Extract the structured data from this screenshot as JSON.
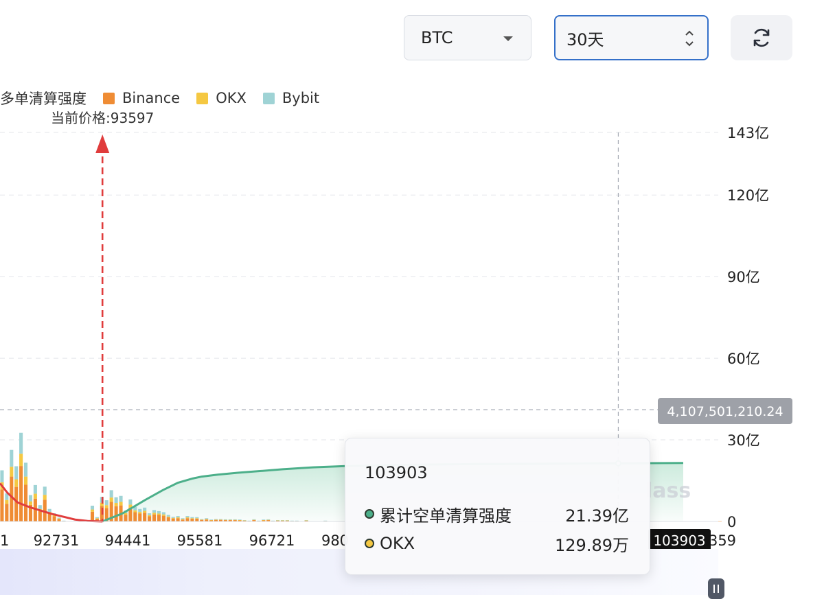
{
  "controls": {
    "coin_select": {
      "value": "BTC"
    },
    "period_select": {
      "value": "30天"
    },
    "refresh": {
      "icon": "refresh-icon"
    }
  },
  "legend": {
    "items": [
      {
        "label": "多单清算强度",
        "color": null
      },
      {
        "label": "Binance",
        "color": "#ef8c34"
      },
      {
        "label": "OKX",
        "color": "#f5c842"
      },
      {
        "label": "Bybit",
        "color": "#9fd3d5"
      }
    ]
  },
  "current_price_label": "当前价格:93597",
  "hover_y_value": "4,107,501,210.24",
  "hover_x_value": "103903",
  "watermark": "lass",
  "tooltip": {
    "title": "103903",
    "rows": [
      {
        "name": "累计空单清算强度",
        "value": "21.39亿",
        "color": "#4caf8a"
      },
      {
        "name": "OKX",
        "value": "129.89万",
        "color": "#f5c842"
      }
    ]
  },
  "chart_data": {
    "type": "bar",
    "y_axis": {
      "position": "right",
      "ticks": [
        {
          "label": "0",
          "value": 0
        },
        {
          "label": "30亿",
          "value": 3000000000
        },
        {
          "label": "60亿",
          "value": 6000000000
        },
        {
          "label": "90亿",
          "value": 9000000000
        },
        {
          "label": "120亿",
          "value": 12000000000
        },
        {
          "label": "143亿",
          "value": 14300000000
        }
      ],
      "ylim": [
        0,
        14300000000
      ]
    },
    "x_axis": {
      "tick_labels": [
        "1",
        "92731",
        "94441",
        "95581",
        "96721",
        "980",
        "103903",
        "359"
      ],
      "xlim": [
        91550,
        105900
      ]
    },
    "current_price": 93597,
    "hover_x": 103903,
    "hover_y": 4107501210.24,
    "x_start": 91590,
    "x_step": 95,
    "stacked_series": [
      {
        "name": "Binance",
        "color": "#ef8c34",
        "values": [
          11.8,
          6.5,
          16.5,
          12.7,
          20.4,
          13.5,
          6.1,
          8.4,
          3.8,
          8.0,
          2.9,
          1.9,
          0.9,
          0.2,
          0.1,
          0.1,
          0.1,
          0.2,
          0.1,
          3.6,
          1.0,
          5.7,
          4.9,
          7.2,
          5.6,
          5.9,
          2.5,
          5.1,
          3.4,
          2.9,
          3.2,
          1.9,
          2.6,
          2.4,
          2.1,
          1.5,
          1.1,
          1.2,
          0.7,
          1.2,
          1.0,
          1.0,
          0.6,
          0.7,
          0.4,
          0.6,
          0.6,
          0.5,
          0.5,
          0.5,
          0.4,
          0.3,
          0.2,
          0.5,
          0.2,
          0.4,
          0.5,
          0.2,
          0.3,
          0.3,
          0.3,
          0.2,
          0.2,
          0.1,
          0.3,
          0.1,
          0.1,
          0.1,
          0.2,
          0.1,
          0.1,
          0.1,
          0.0,
          0.1,
          0.0,
          0.1,
          0.0,
          0.0,
          0.1,
          0.0,
          0.0,
          0.0,
          0.0,
          0.0,
          0.0,
          0.0,
          0.0,
          0.0,
          0.1,
          0.0,
          0.1,
          0.0,
          0.0,
          0.0,
          0.0,
          0.1,
          0.0,
          0.0,
          0.0,
          0.0,
          0.1,
          0.0,
          0.1,
          0.0,
          0.1,
          0.0,
          0.1,
          0.1,
          0.1,
          0.1,
          0.1,
          0.1,
          0.1,
          0.1,
          0.1,
          0.0,
          0.1,
          0.0,
          0.0,
          0.0,
          0.1,
          0.0,
          0.0,
          0.0,
          0.0,
          0.1,
          0.1,
          0.1,
          0.0,
          0.0,
          0.0,
          0.0,
          0.0,
          0.0,
          0.0,
          0.0,
          0.0,
          0.0,
          0.1,
          0.0,
          0.0,
          0.0,
          0.0,
          0.0,
          0.0,
          0.0,
          0.1,
          0.0,
          0.1,
          0.0,
          0.1,
          0.1,
          0.0,
          0.0,
          0.0,
          0.0,
          0.0
        ]
      },
      {
        "name": "OKX",
        "color": "#f5c842",
        "values": [
          2.6,
          1.4,
          3.6,
          2.8,
          4.5,
          3.0,
          1.3,
          1.8,
          0.8,
          1.8,
          0.6,
          0.4,
          0.2,
          0.0,
          0.0,
          0.0,
          0.0,
          0.0,
          0.0,
          0.8,
          0.2,
          1.2,
          1.1,
          1.6,
          1.2,
          1.3,
          0.6,
          1.1,
          0.7,
          0.6,
          0.7,
          0.4,
          0.6,
          0.5,
          0.5,
          0.3,
          0.2,
          0.3,
          0.2,
          0.3,
          0.2,
          0.2,
          0.1,
          0.2,
          0.1,
          0.1,
          0.1,
          0.1,
          0.1,
          0.1,
          0.1,
          0.1,
          0.0,
          0.1,
          0.0,
          0.1,
          0.1,
          0.0,
          0.1,
          0.1,
          0.1,
          0.0,
          0.0,
          0.0,
          0.1,
          0.0,
          0.0,
          0.0,
          0.0,
          0.0,
          0.0,
          0.0,
          0.0,
          0.0,
          0.0,
          0.0,
          0.0,
          0.0,
          0.0,
          0.0,
          0.0,
          0.0,
          0.0,
          0.0,
          0.0,
          0.0,
          0.0,
          0.0,
          0.0,
          0.0,
          0.0,
          0.0,
          0.0,
          0.0,
          0.0,
          0.0,
          0.0,
          0.0,
          0.0,
          0.0,
          0.0,
          0.0,
          0.0,
          0.0,
          0.0,
          0.0,
          0.0,
          0.0,
          0.0,
          0.0,
          0.0,
          0.0,
          0.0,
          0.0,
          0.0,
          0.0,
          0.0,
          0.0,
          0.0,
          0.0,
          0.0,
          0.0,
          0.0,
          0.0,
          0.0,
          0.0,
          0.0,
          0.0,
          0.0,
          0.0,
          0.0,
          0.0,
          0.0,
          0.0,
          0.0,
          0.0,
          0.0,
          0.0,
          0.0,
          0.0,
          0.0,
          0.0,
          0.0,
          0.0,
          0.0,
          0.0,
          0.0,
          0.0,
          0.0,
          0.0,
          0.0,
          0.0,
          0.0,
          0.0,
          0.0,
          0.0,
          0.0,
          0.0,
          0.0
        ]
      },
      {
        "name": "Bybit",
        "color": "#9fd3d5",
        "values": [
          4.4,
          2.4,
          6.2,
          4.8,
          7.7,
          5.1,
          2.3,
          3.2,
          1.4,
          3.0,
          1.1,
          0.7,
          0.3,
          0.1,
          0.0,
          0.0,
          0.0,
          0.1,
          0.0,
          1.4,
          0.4,
          2.1,
          1.8,
          2.7,
          2.1,
          2.2,
          0.9,
          1.9,
          1.3,
          1.1,
          1.2,
          0.7,
          1.0,
          0.9,
          0.8,
          0.6,
          0.4,
          0.5,
          0.3,
          0.5,
          0.4,
          0.4,
          0.2,
          0.3,
          0.2,
          0.2,
          0.2,
          0.2,
          0.2,
          0.2,
          0.2,
          0.1,
          0.1,
          0.2,
          0.1,
          0.2,
          0.2,
          0.1,
          0.1,
          0.1,
          0.1,
          0.1,
          0.1,
          0.0,
          0.1,
          0.0,
          0.0,
          0.0,
          0.1,
          0.0,
          0.0,
          0.0,
          0.0,
          0.0,
          0.0,
          0.0,
          0.0,
          0.0,
          0.0,
          0.0,
          0.0,
          0.0,
          0.0,
          0.0,
          0.0,
          0.0,
          0.0,
          0.0,
          0.0,
          0.0,
          0.0,
          0.0,
          0.0,
          0.0,
          0.0,
          0.0,
          0.0,
          0.0,
          0.0,
          0.0,
          0.0,
          0.0,
          0.0,
          0.0,
          0.0,
          0.0,
          0.0,
          0.0,
          0.0,
          0.0,
          0.0,
          0.0,
          0.0,
          0.0,
          0.0,
          0.0,
          0.0,
          0.0,
          0.0,
          0.0,
          0.0,
          0.0,
          0.0,
          0.0,
          0.0,
          0.0,
          0.0,
          0.0,
          0.0,
          0.0,
          0.0,
          0.0,
          0.0,
          0.0,
          0.0,
          0.0,
          0.0,
          0.0,
          0.0,
          0.0,
          0.0,
          0.0,
          0.0,
          0.0,
          0.0,
          0.0,
          0.0,
          0.0,
          0.0,
          0.0,
          0.0,
          0.0,
          0.0,
          0.0,
          0.0,
          0.0,
          0.0,
          0.0,
          0.0
        ]
      }
    ],
    "cumulative_long": {
      "color": "#e03c3c",
      "x": [
        91550,
        91700,
        91900,
        92150,
        92400,
        92600,
        92850,
        93050,
        93300,
        93597
      ],
      "y": [
        1400000000,
        1050000000,
        700000000,
        520000000,
        380000000,
        270000000,
        160000000,
        70000000,
        20000000,
        0
      ]
    },
    "cumulative_short": {
      "name": "累计空单清算强度",
      "color": "#4caf8a",
      "x": [
        93597,
        94000,
        94441,
        94800,
        95100,
        95400,
        95581,
        95900,
        96300,
        96721,
        97200,
        97800,
        98500,
        99200,
        100000,
        101000,
        102000,
        103000,
        103903,
        105200
      ],
      "y": [
        0,
        300000000,
        780000000,
        1150000000,
        1420000000,
        1580000000,
        1650000000,
        1720000000,
        1790000000,
        1850000000,
        1920000000,
        1990000000,
        2040000000,
        2070000000,
        2090000000,
        2110000000,
        2120000000,
        2130000000,
        2139000000,
        2150000000
      ]
    }
  }
}
